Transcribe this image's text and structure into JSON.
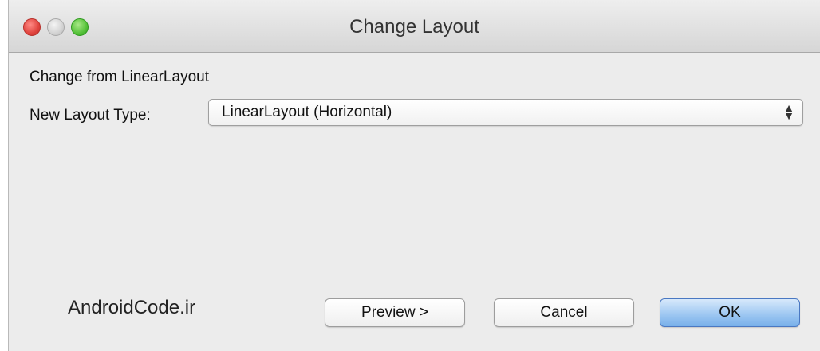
{
  "window": {
    "title": "Change Layout"
  },
  "content": {
    "change_from": "Change from LinearLayout",
    "layout_type_label": "New Layout Type:",
    "layout_type_value": "LinearLayout (Horizontal)",
    "select_arrows_icon": "up-down-arrows",
    "watermark": "AndroidCode.ir"
  },
  "buttons": {
    "preview": "Preview >",
    "cancel": "Cancel",
    "ok": "OK"
  },
  "colors": {
    "close": "#e0443e",
    "minimize": "#d3d3d3",
    "zoom": "#56c23a",
    "default_button": "#9fc8f2"
  }
}
